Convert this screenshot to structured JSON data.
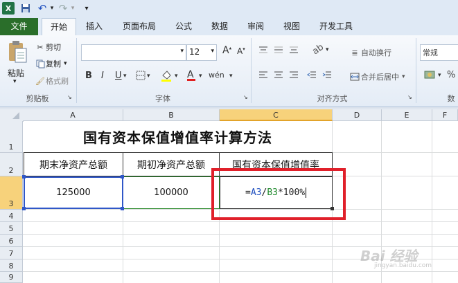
{
  "qat": {
    "items": [
      {
        "name": "excel-logo-icon",
        "glyph": "X"
      },
      {
        "name": "save-icon",
        "glyph": "💾"
      },
      {
        "name": "undo-icon",
        "glyph": "↶"
      },
      {
        "name": "redo-icon",
        "glyph": "↷"
      },
      {
        "name": "customize-icon",
        "glyph": "▾"
      }
    ]
  },
  "tabs": {
    "file": "文件",
    "items": [
      "开始",
      "插入",
      "页面布局",
      "公式",
      "数据",
      "审阅",
      "视图",
      "开发工具"
    ],
    "active": "开始"
  },
  "ribbon": {
    "clipboard": {
      "paste": "粘贴",
      "cut": "剪切",
      "copy": "复制",
      "format_painter": "格式刷",
      "group": "剪贴板"
    },
    "font": {
      "font_name": "",
      "font_size": "12",
      "group": "字体"
    },
    "alignment": {
      "wrap_text": "自动换行",
      "merge_center": "合并后居中",
      "group": "对齐方式"
    },
    "number": {
      "format": "常规",
      "group": "数"
    }
  },
  "sheet": {
    "columns": [
      "A",
      "B",
      "C",
      "D",
      "E",
      "F"
    ],
    "rows": [
      "1",
      "2",
      "3",
      "4",
      "5",
      "6",
      "7",
      "8",
      "9"
    ],
    "title": "国有资本保值增值率计算方法",
    "headers": [
      "期末净资产总额",
      "期初净资产总额",
      "国有资本保值增值率"
    ],
    "values": [
      "125000",
      "100000"
    ],
    "formula": {
      "eq": "=",
      "ref1": "A3",
      "slash": "/",
      "ref2": "B3",
      "rest": "*100%",
      "ref1_color": "#1f4fbf",
      "ref2_color": "#1f8a2c"
    }
  },
  "watermark": {
    "text": "Bai 经验",
    "url": "jingyan.baidu.com"
  },
  "colors": {
    "file_tab": "#2a6e2a",
    "highlight": "#e0202a",
    "selected_header": "#f7d27b"
  }
}
